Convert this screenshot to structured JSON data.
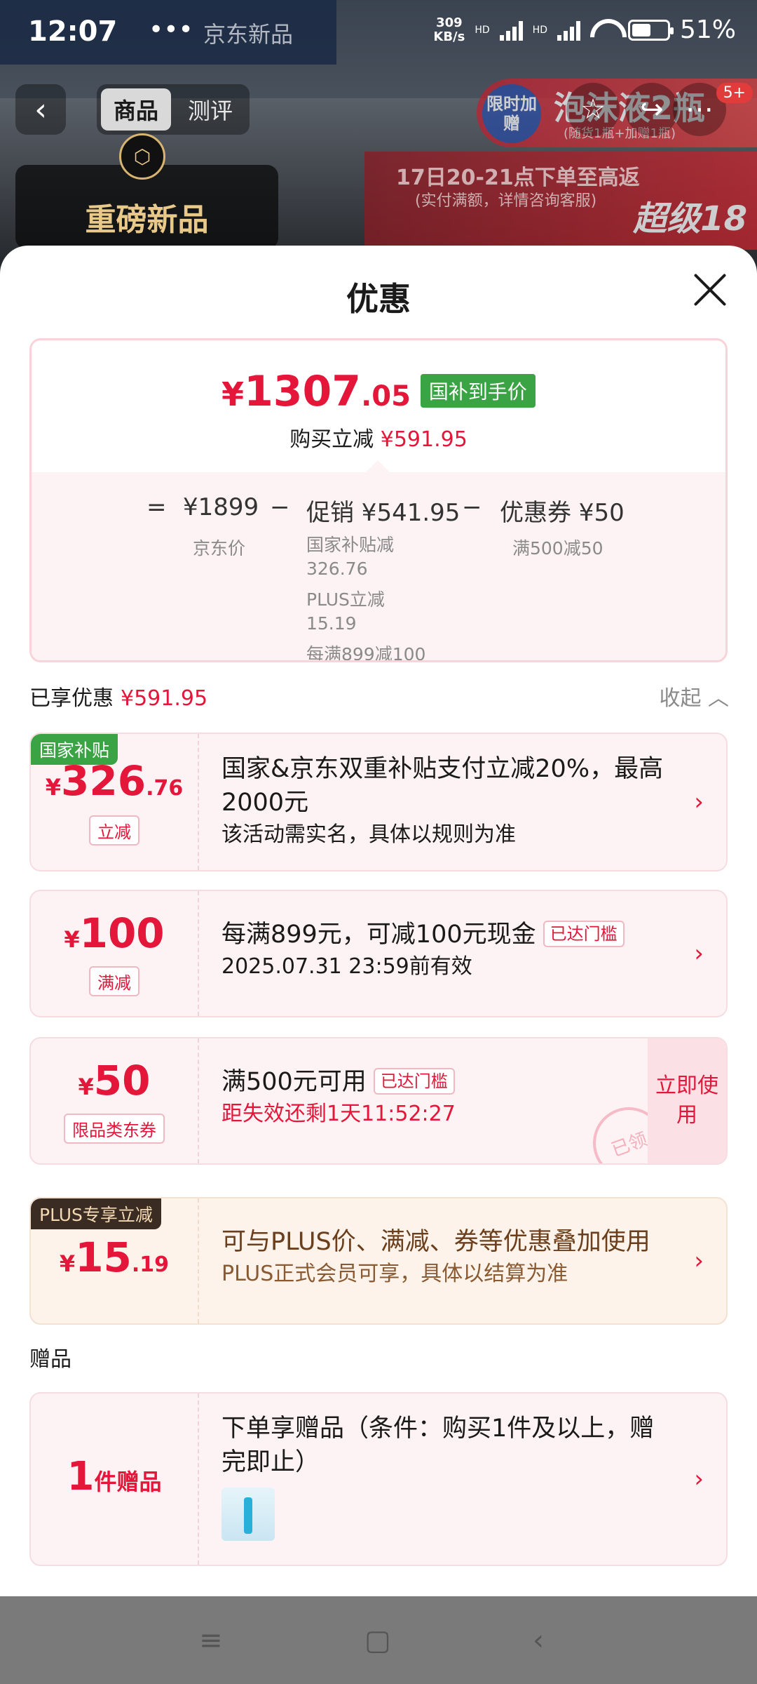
{
  "status_bar": {
    "time": "12:07",
    "menu_dots": "•••",
    "brand": "京东新品",
    "net_speed": "309",
    "net_unit": "KB/s",
    "signal1": "HD",
    "signal2": "HD",
    "battery": "51%"
  },
  "product_header": {
    "tabs": [
      "商品",
      "测评"
    ],
    "new_tag": "重磅新品",
    "promo_badge": "限时加赠",
    "promo_title": "泡沫液2瓶",
    "promo_sub": "(随货1瓶+加赠1瓶)",
    "promo2_title": "17日20-21点下单至高返",
    "promo2_sub": "(实付满额，详情咨询客服)",
    "promo2_big": "超级18",
    "cart_badge": "5+"
  },
  "sheet": {
    "title": "优惠",
    "summary": {
      "yen": "¥",
      "price_int": "1307",
      "price_dec": ".05",
      "price_tag": "国补到手价",
      "reduce_label": "购买立减",
      "reduce_value": "¥591.95",
      "eq": "=",
      "base_price": "¥1899",
      "base_label": "京东价",
      "minus1": "−",
      "promo_label": "促销 ¥541.95",
      "promo_items": [
        "国家补贴减",
        "326.76",
        "PLUS立减15.19",
        "每满899减100"
      ],
      "minus2": "−",
      "coupon_label": "优惠券 ¥50",
      "coupon_item": "满500减50"
    },
    "enjoyed": {
      "label": "已享优惠",
      "value": "¥591.95",
      "collapse": "收起"
    },
    "cards": [
      {
        "corner": "国家补贴",
        "yen": "¥",
        "amt": "326",
        "dec": ".76",
        "kind": "立减",
        "title": "国家&京东双重补贴支付立减20%，最高2000元",
        "desc": "该活动需实名，具体以规则为准",
        "arrow": "›"
      },
      {
        "yen": "¥",
        "amt": "100",
        "kind": "满减",
        "title": "每满899元，可减100元现金",
        "reached": "已达门槛",
        "desc": "2025.07.31 23:59前有效",
        "arrow": "›"
      },
      {
        "yen": "¥",
        "amt": "50",
        "kind": "限品类东券",
        "title": "满500元可用",
        "reached": "已达门槛",
        "desc": "距失效还剩1天11:52:27",
        "use_now": "立即使用",
        "stamp": "已领"
      },
      {
        "corner": "PLUS专享立减",
        "yen": "¥",
        "amt": "15",
        "dec": ".19",
        "title": "可与PLUS价、满减、券等优惠叠加使用",
        "desc": "PLUS正式会员可享，具体以结算为准",
        "arrow": "›"
      }
    ],
    "gift_section": "赠品",
    "gift": {
      "count": "1",
      "unit": "件赠品",
      "title": "下单享赠品（条件：购买1件及以上，赠完即止）",
      "arrow": "›"
    }
  }
}
